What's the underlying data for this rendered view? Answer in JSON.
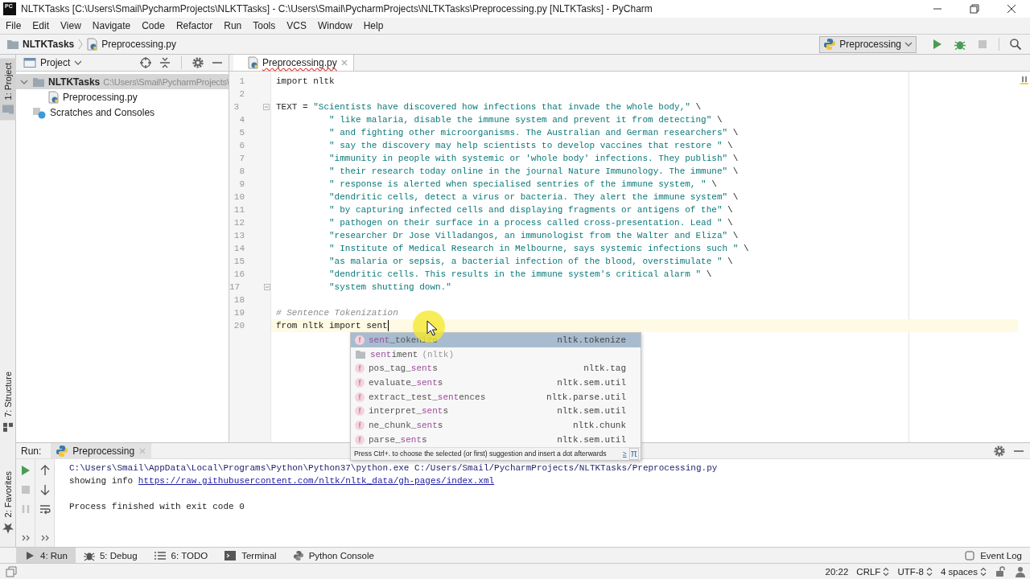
{
  "window": {
    "app_icon": "PC",
    "title": "NLTKTasks [C:\\Users\\Smail\\PycharmProjects\\NLKTTasks] - C:\\Users\\Smail\\PycharmProjects\\NLTKTasks\\Preprocessing.py [NLTKTasks] - PyCharm"
  },
  "menu": [
    "File",
    "Edit",
    "View",
    "Navigate",
    "Code",
    "Refactor",
    "Run",
    "Tools",
    "VCS",
    "Window",
    "Help"
  ],
  "navigation": {
    "breadcrumbs": [
      {
        "kind": "folder",
        "label": "NLTKTasks"
      },
      {
        "kind": "python-file",
        "label": "Preprocessing.py"
      }
    ],
    "run_config": "Preprocessing",
    "actions": [
      {
        "kind": "run",
        "disabled": false
      },
      {
        "kind": "debug",
        "disabled": false
      },
      {
        "kind": "stop",
        "disabled": true
      }
    ]
  },
  "side_strip": [
    {
      "kind": "project",
      "label": "1: Project",
      "selected": true
    },
    {
      "kind": "structure",
      "label": "7: Structure",
      "selected": false
    },
    {
      "kind": "favorites",
      "label": "2: Favorites",
      "selected": false
    }
  ],
  "project_panel": {
    "title": "Project",
    "tree": [
      {
        "kind": "folder",
        "label": "NLTKTasks",
        "path": "C:\\Users\\Smail\\PycharmProjects\\",
        "selected": true,
        "expanded": true,
        "children": [
          {
            "kind": "python-file",
            "label": "Preprocessing.py",
            "selected": false
          }
        ]
      },
      {
        "kind": "scratches",
        "label": "Scratches and Consoles",
        "selected": false
      }
    ]
  },
  "editor": {
    "tabs": [
      {
        "label": "Preprocessing.py",
        "selected": true
      }
    ],
    "lines": [
      {
        "number": "1",
        "current": false,
        "fold": false,
        "indent": false,
        "tokens": [
          {
            "kind": "plain",
            "text": "import nltk"
          }
        ]
      },
      {
        "number": "2",
        "current": false,
        "fold": false
      },
      {
        "number": "3",
        "current": false,
        "fold": true,
        "indent": false,
        "tokens": [
          {
            "kind": "plain",
            "text": "TEXT = "
          },
          {
            "kind": "string",
            "text": "\"Scientists have discovered how infections that invade the whole body,\""
          },
          {
            "kind": "plain",
            "text": " \\"
          }
        ]
      },
      {
        "number": "4",
        "current": false,
        "fold": false,
        "indent": true,
        "tokens": [
          {
            "kind": "string",
            "text": "\" like malaria, disable the immune system and prevent it from detecting\""
          },
          {
            "kind": "plain",
            "text": " \\"
          }
        ]
      },
      {
        "number": "5",
        "current": false,
        "fold": false,
        "indent": true,
        "tokens": [
          {
            "kind": "string",
            "text": "\" and fighting other microorganisms. The Australian and German researchers\""
          },
          {
            "kind": "plain",
            "text": " \\"
          }
        ]
      },
      {
        "number": "6",
        "current": false,
        "fold": false,
        "indent": true,
        "tokens": [
          {
            "kind": "string",
            "text": "\" say the discovery may help scientists to develop vaccines that restore \""
          },
          {
            "kind": "plain",
            "text": " \\"
          }
        ]
      },
      {
        "number": "7",
        "current": false,
        "fold": false,
        "indent": true,
        "tokens": [
          {
            "kind": "string",
            "text": "\"immunity in people with systemic or 'whole body' infections. They publish\""
          },
          {
            "kind": "plain",
            "text": " \\"
          }
        ]
      },
      {
        "number": "8",
        "current": false,
        "fold": false,
        "indent": true,
        "tokens": [
          {
            "kind": "string",
            "text": "\" their research today online in the journal Nature Immunology. The immune\""
          },
          {
            "kind": "plain",
            "text": " \\"
          }
        ]
      },
      {
        "number": "9",
        "current": false,
        "fold": false,
        "indent": true,
        "tokens": [
          {
            "kind": "string",
            "text": "\" response is alerted when specialised sentries of the immune system, \""
          },
          {
            "kind": "plain",
            "text": " \\"
          }
        ]
      },
      {
        "number": "10",
        "current": false,
        "fold": false,
        "indent": true,
        "tokens": [
          {
            "kind": "string",
            "text": "\"dendritic cells, detect a virus or bacteria. They alert the immune system\""
          },
          {
            "kind": "plain",
            "text": " \\"
          }
        ]
      },
      {
        "number": "11",
        "current": false,
        "fold": false,
        "indent": true,
        "tokens": [
          {
            "kind": "string",
            "text": "\" by capturing infected cells and displaying fragments or antigens of the\""
          },
          {
            "kind": "plain",
            "text": " \\"
          }
        ]
      },
      {
        "number": "12",
        "current": false,
        "fold": false,
        "indent": true,
        "tokens": [
          {
            "kind": "string",
            "text": "\" pathogen on their surface in a process called cross-presentation. Lead \""
          },
          {
            "kind": "plain",
            "text": " \\"
          }
        ]
      },
      {
        "number": "13",
        "current": false,
        "fold": false,
        "indent": true,
        "tokens": [
          {
            "kind": "string",
            "text": "\"researcher Dr Jose Villadangos, an immunologist from the Walter and Eliza\""
          },
          {
            "kind": "plain",
            "text": " \\"
          }
        ]
      },
      {
        "number": "14",
        "current": false,
        "fold": false,
        "indent": true,
        "tokens": [
          {
            "kind": "string",
            "text": "\" Institute of Medical Research in Melbourne, says systemic infections such \""
          },
          {
            "kind": "plain",
            "text": " \\"
          }
        ]
      },
      {
        "number": "15",
        "current": false,
        "fold": false,
        "indent": true,
        "tokens": [
          {
            "kind": "string",
            "text": "\"as malaria or sepsis, a bacterial infection of the blood, overstimulate \""
          },
          {
            "kind": "plain",
            "text": " \\"
          }
        ]
      },
      {
        "number": "16",
        "current": false,
        "fold": false,
        "indent": true,
        "tokens": [
          {
            "kind": "string",
            "text": "\"dendritic cells. This results in the immune system's critical alarm \""
          },
          {
            "kind": "plain",
            "text": " \\"
          }
        ]
      },
      {
        "number": "17",
        "current": false,
        "fold": true,
        "indent": true,
        "tokens": [
          {
            "kind": "string",
            "text": "\"system shutting down.\""
          }
        ]
      },
      {
        "number": "18",
        "current": false,
        "fold": false
      },
      {
        "number": "19",
        "current": false,
        "fold": false,
        "indent": false,
        "tokens": [
          {
            "kind": "comment",
            "text": "# Sentence Tokenization"
          }
        ]
      },
      {
        "number": "20",
        "current": true,
        "fold": false,
        "indent": false,
        "tokens": [
          {
            "kind": "plain",
            "text": "from nltk import sent"
          }
        ]
      }
    ]
  },
  "completion": {
    "items": [
      {
        "kind": "function",
        "badge": "f",
        "selected": true,
        "name": [
          {
            "text": "sent",
            "match": true
          },
          {
            "text": "_tokenize",
            "match": false
          }
        ],
        "module": "nltk.tokenize"
      },
      {
        "kind": "package",
        "selected": false,
        "name": [
          {
            "text": "sent",
            "match": true
          },
          {
            "text": "iment",
            "match": false
          }
        ],
        "tail": "(nltk)"
      },
      {
        "kind": "function",
        "badge": "f",
        "selected": false,
        "name": [
          {
            "text": "pos_tag_",
            "match": false
          },
          {
            "text": "sent",
            "match": true
          },
          {
            "text": "s",
            "match": false
          }
        ],
        "module": "nltk.tag"
      },
      {
        "kind": "function",
        "badge": "f",
        "selected": false,
        "name": [
          {
            "text": "evaluate_",
            "match": false
          },
          {
            "text": "sent",
            "match": true
          },
          {
            "text": "s",
            "match": false
          }
        ],
        "module": "nltk.sem.util"
      },
      {
        "kind": "function",
        "badge": "f",
        "selected": false,
        "name": [
          {
            "text": "extract_test_",
            "match": false
          },
          {
            "text": "sent",
            "match": true
          },
          {
            "text": "ences",
            "match": false
          }
        ],
        "module": "nltk.parse.util"
      },
      {
        "kind": "function",
        "badge": "f",
        "selected": false,
        "name": [
          {
            "text": "interpret_",
            "match": false
          },
          {
            "text": "sent",
            "match": true
          },
          {
            "text": "s",
            "match": false
          }
        ],
        "module": "nltk.sem.util"
      },
      {
        "kind": "function",
        "badge": "f",
        "selected": false,
        "name": [
          {
            "text": "ne_chunk_",
            "match": false
          },
          {
            "text": "sent",
            "match": true
          },
          {
            "text": "s",
            "match": false
          }
        ],
        "module": "nltk.chunk"
      },
      {
        "kind": "function",
        "badge": "f",
        "selected": false,
        "name": [
          {
            "text": "parse_",
            "match": false
          },
          {
            "text": "sent",
            "match": true
          },
          {
            "text": "s",
            "match": false
          }
        ],
        "module": "nltk.sem.util"
      }
    ],
    "hint": "Press Ctrl+. to choose the selected (or first) suggestion and insert a dot afterwards",
    "hint_link": "≥",
    "pi": "π"
  },
  "run_panel": {
    "label": "Run:",
    "tabs": [
      {
        "label": "Preprocessing",
        "selected": true
      }
    ],
    "controls": [
      {
        "kind": "run",
        "disabled": false
      },
      {
        "kind": "stop",
        "disabled": true
      },
      {
        "kind": "pause",
        "disabled": true
      }
    ],
    "console": [
      {
        "kind": "command",
        "text": "C:\\Users\\Smail\\AppData\\Local\\Programs\\Python\\Python37\\python.exe C:/Users/Smail/PycharmProjects/NLTKTasks/Preprocessing.py"
      },
      {
        "kind": "info",
        "text": "showing info ",
        "link": "https://raw.githubusercontent.com/nltk/nltk_data/gh-pages/index.xml"
      },
      {
        "kind": "blank"
      },
      {
        "kind": "result",
        "text": "Process finished with exit code 0"
      }
    ]
  },
  "tool_windows": [
    {
      "kind": "run",
      "label": "4: Run",
      "selected": true
    },
    {
      "kind": "debug",
      "label": "5: Debug",
      "selected": false
    },
    {
      "kind": "todo",
      "label": "6: TODO",
      "selected": false
    },
    {
      "kind": "terminal",
      "label": "Terminal",
      "selected": false
    },
    {
      "kind": "python",
      "label": "Python Console",
      "selected": false
    }
  ],
  "event_log": "Event Log",
  "status_bar": [
    {
      "kind": "position",
      "text": "20:22"
    },
    {
      "kind": "selector",
      "text": "CRLF"
    },
    {
      "kind": "selector",
      "text": "UTF-8"
    },
    {
      "kind": "selector",
      "text": "4 spaces"
    }
  ]
}
